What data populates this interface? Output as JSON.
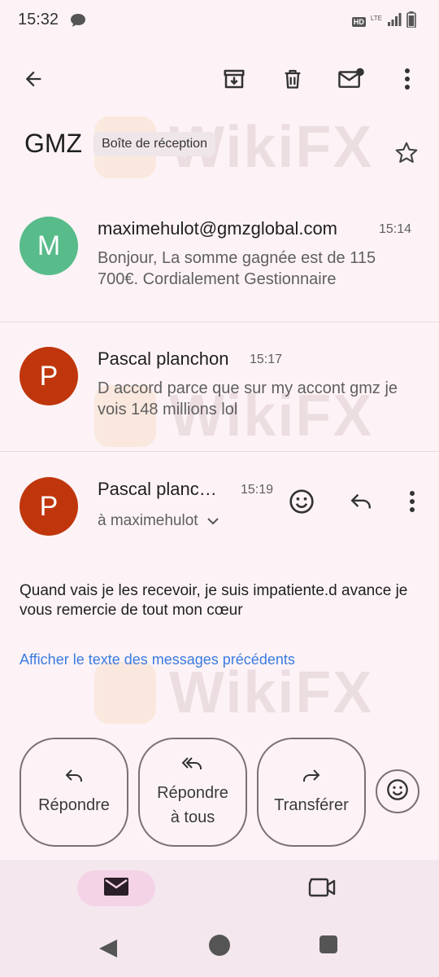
{
  "status_bar": {
    "time": "15:32",
    "network": "LTE",
    "hd": "HD"
  },
  "toolbar": {
    "back_icon": "arrow-back-icon",
    "archive_icon": "archive-icon",
    "delete_icon": "trash-icon",
    "mark_unread_icon": "mail-unread-icon",
    "more_icon": "more-vert-icon"
  },
  "thread": {
    "subject": "GMZ",
    "label": "Boîte de réception"
  },
  "messages": [
    {
      "avatar_letter": "M",
      "avatar_color": "#57bb8a",
      "sender": "maximehulot@gmzglobal.com",
      "time": "15:14",
      "snippet": "Bonjour, La somme gagnée est de 115 700€. Cordialement Gestionnaire"
    },
    {
      "avatar_letter": "P",
      "avatar_color": "#c0360c",
      "sender": "Pascal planchon",
      "time": "15:17",
      "snippet": "D accord parce que sur my accont gmz je vois 148 millions lol"
    },
    {
      "avatar_letter": "P",
      "avatar_color": "#c0360c",
      "sender": "Pascal planc…",
      "time": "15:19",
      "recipient": "à maximehulot",
      "body": "Quand vais je les recevoir, je suis impatiente.d avance je vous remercie de tout mon cœur",
      "show_quoted": "Afficher le texte des messages précédents"
    }
  ],
  "actions": {
    "reply": "Répondre",
    "reply_all_line1": "Répondre",
    "reply_all_line2": "à tous",
    "forward": "Transférer"
  },
  "watermark": "WikiFX",
  "accent_color": "#3a7be0"
}
